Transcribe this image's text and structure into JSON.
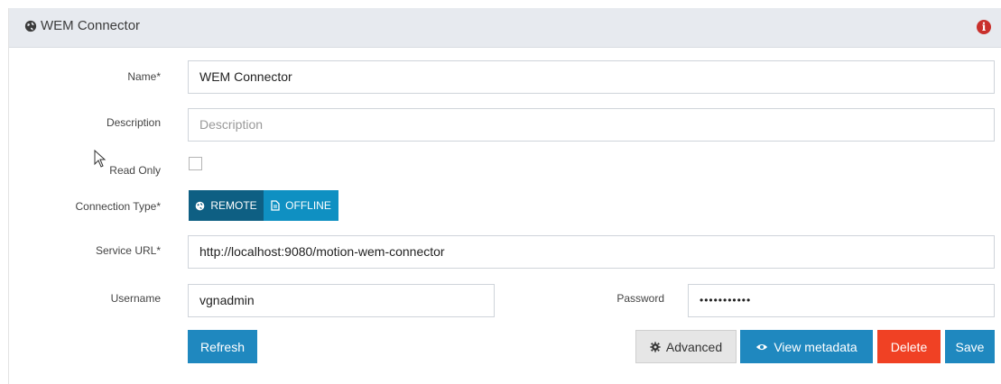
{
  "header": {
    "title": "WEM Connector",
    "icon": "globe-icon",
    "info_icon": "info-circle-icon",
    "info_color": "#c9302c"
  },
  "form": {
    "name": {
      "label": "Name*",
      "value": "WEM Connector"
    },
    "description": {
      "label": "Description",
      "placeholder": "Description"
    },
    "read_only": {
      "label": "Read Only",
      "checked": false
    },
    "connection_type": {
      "label": "Connection Type*",
      "options": [
        "REMOTE",
        "OFFLINE"
      ],
      "selected": "REMOTE"
    },
    "service_url": {
      "label": "Service URL*",
      "value": "http://localhost:9080/motion-wem-connector"
    },
    "username": {
      "label": "Username",
      "value": "vgnadmin"
    },
    "password": {
      "label": "Password",
      "value": "•••••••••••"
    }
  },
  "buttons": {
    "refresh": "Refresh",
    "advanced": "Advanced",
    "view_metadata": "View metadata",
    "delete": "Delete",
    "save": "Save"
  },
  "colors": {
    "primary": "#1f88bf",
    "remote_active": "#0e5f83",
    "offline": "#0f90c2",
    "danger": "#f04124",
    "header_bg": "#e7eaef"
  }
}
